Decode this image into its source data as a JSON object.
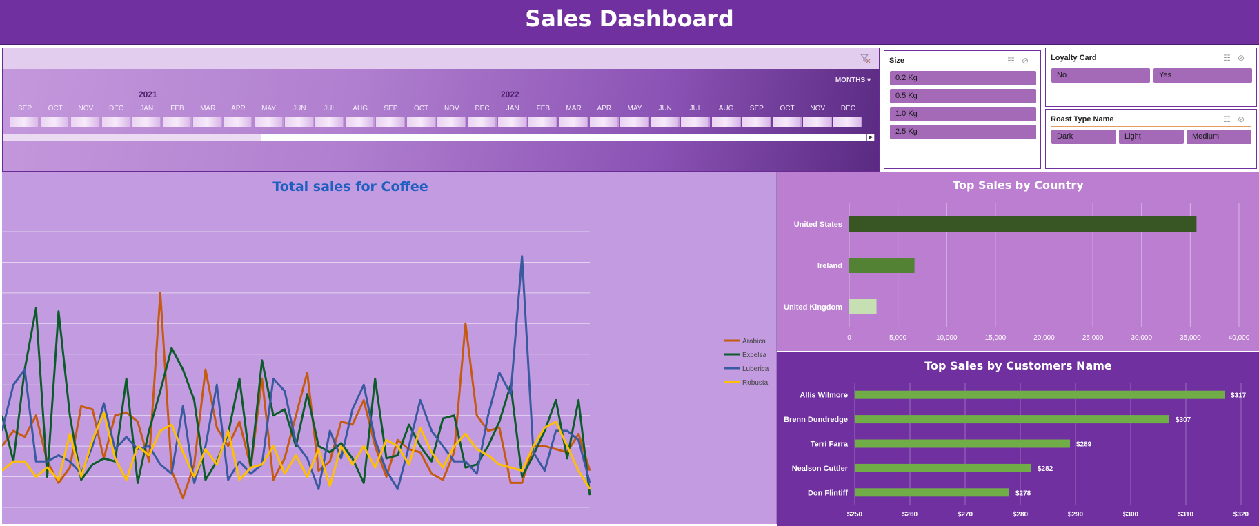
{
  "header": {
    "title": "Sales Dashboard"
  },
  "timeline": {
    "period_button": "MONTHS",
    "years": [
      "2021",
      "2022"
    ],
    "months": [
      "SEP",
      "OCT",
      "NOV",
      "DEC",
      "JAN",
      "FEB",
      "MAR",
      "APR",
      "MAY",
      "JUN",
      "JUL",
      "AUG",
      "SEP",
      "OCT",
      "NOV",
      "DEC",
      "JAN",
      "FEB",
      "MAR",
      "APR",
      "MAY",
      "JUN",
      "JUL",
      "AUG",
      "SEP",
      "OCT",
      "NOV",
      "DEC"
    ]
  },
  "slicers": {
    "size": {
      "title": "Size",
      "items": [
        "0.2 Kg",
        "0.5 Kg",
        "1.0 Kg",
        "2.5 Kg"
      ]
    },
    "loyalty": {
      "title": "Loyalty Card",
      "items": [
        "No",
        "Yes"
      ]
    },
    "roast": {
      "title": "Roast Type Name",
      "items": [
        "Dark",
        "Light",
        "Medium"
      ]
    }
  },
  "colors": {
    "header_bg": "#7030a0",
    "arabica": "#c55a11",
    "excelsa": "#0b5c2a",
    "luberica": "#3a5aa0",
    "robusta": "#ffc000",
    "us_bar": "#375623",
    "ireland_bar": "#548235",
    "uk_bar": "#c6e0b4",
    "customer_bar": "#70ad47"
  },
  "chart_data": [
    {
      "type": "line",
      "title": "Total sales for Coffee",
      "ylim": [
        0,
        900
      ],
      "grid": true,
      "legend": "right",
      "series": [
        {
          "name": "Arabica",
          "values": [
            200,
            250,
            230,
            300,
            150,
            80,
            130,
            330,
            320,
            160,
            300,
            310,
            280,
            150,
            700,
            120,
            30,
            140,
            450,
            260,
            200,
            280,
            130,
            420,
            90,
            160,
            300,
            440,
            120,
            150,
            280,
            270,
            350,
            200,
            100,
            220,
            190,
            180,
            110,
            90,
            180,
            600,
            300,
            250,
            260,
            80,
            80,
            200,
            200,
            190,
            180,
            240,
            120
          ]
        },
        {
          "name": "Excelsa",
          "values": [
            300,
            150,
            450,
            650,
            100,
            640,
            300,
            90,
            140,
            160,
            150,
            420,
            80,
            250,
            380,
            520,
            450,
            350,
            90,
            150,
            240,
            420,
            130,
            480,
            300,
            320,
            200,
            370,
            200,
            180,
            210,
            160,
            80,
            420,
            160,
            170,
            270,
            200,
            150,
            290,
            300,
            130,
            140,
            200,
            280,
            400,
            100,
            170,
            250,
            350,
            160,
            350,
            40
          ]
        },
        {
          "name": "Luberica",
          "values": [
            250,
            400,
            450,
            150,
            150,
            170,
            150,
            110,
            200,
            340,
            190,
            230,
            190,
            200,
            140,
            110,
            330,
            80,
            200,
            400,
            90,
            150,
            110,
            140,
            420,
            380,
            210,
            160,
            60,
            250,
            160,
            320,
            400,
            220,
            120,
            60,
            200,
            350,
            250,
            200,
            150,
            150,
            110,
            300,
            440,
            370,
            820,
            180,
            120,
            250,
            250,
            220,
            80
          ]
        },
        {
          "name": "Robusta",
          "values": [
            120,
            150,
            150,
            100,
            130,
            90,
            240,
            100,
            220,
            310,
            160,
            90,
            200,
            170,
            250,
            270,
            180,
            100,
            190,
            140,
            250,
            90,
            130,
            140,
            200,
            110,
            170,
            100,
            190,
            70,
            200,
            140,
            200,
            130,
            220,
            200,
            140,
            260,
            180,
            130,
            200,
            240,
            190,
            170,
            140,
            130,
            120,
            200,
            260,
            280,
            200,
            120,
            60
          ]
        }
      ]
    },
    {
      "type": "bar",
      "orientation": "horizontal",
      "title": "Top Sales by Country",
      "categories": [
        "United States",
        "Ireland",
        "United Kingdom"
      ],
      "values": [
        35639,
        6697,
        2799
      ],
      "xlim": [
        0,
        40000
      ],
      "xticks": [
        "0",
        "5,000",
        "10,000",
        "15,000",
        "20,000",
        "25,000",
        "30,000",
        "35,000",
        "40,000"
      ]
    },
    {
      "type": "bar",
      "orientation": "horizontal",
      "title": "Top Sales by Customers Name",
      "categories": [
        "Allis Wilmore",
        "Brenn Dundredge",
        "Terri Farra",
        "Nealson Cuttler",
        "Don Flintiff"
      ],
      "values": [
        317,
        307,
        289,
        282,
        278
      ],
      "value_labels": [
        "$317",
        "$307",
        "$289",
        "$282",
        "$278"
      ],
      "xlim": [
        250,
        320
      ],
      "xticks": [
        "$250",
        "$260",
        "$270",
        "$280",
        "$290",
        "$300",
        "$310",
        "$320"
      ]
    }
  ]
}
